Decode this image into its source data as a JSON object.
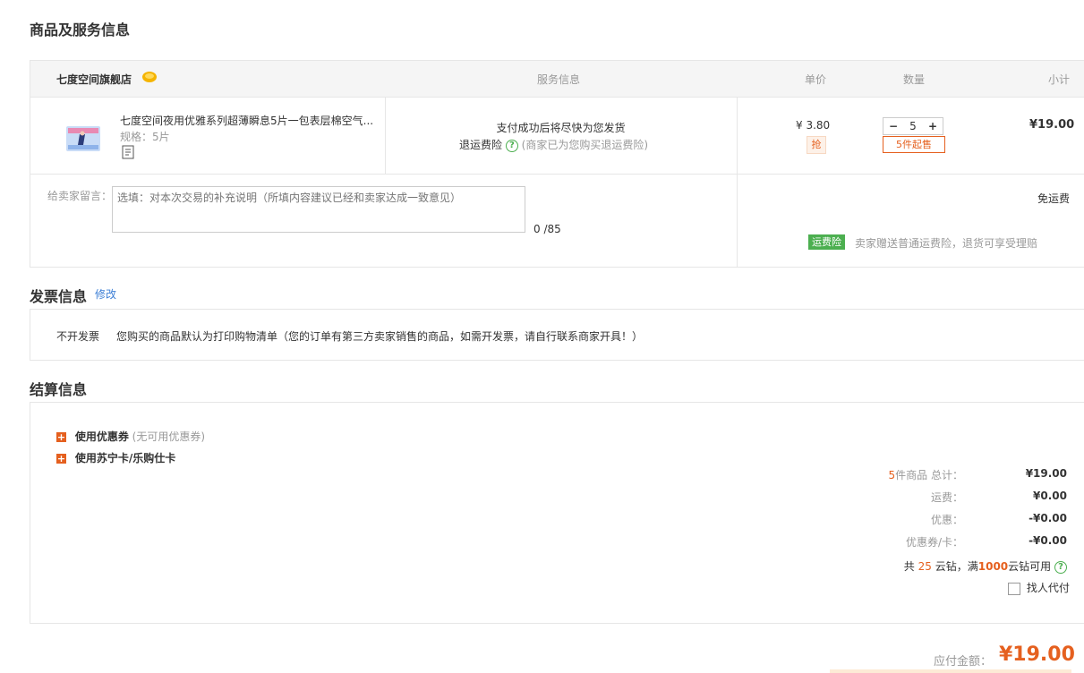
{
  "goods": {
    "title": "商品及服务信息",
    "headers": {
      "store": "七度空间旗舰店",
      "service": "服务信息",
      "price": "单价",
      "qty": "数量",
      "subtotal": "小计"
    },
    "item": {
      "name": "七度空间夜用优雅系列超薄瞬息5片一包表层棉空气...",
      "spec": "规格：5片",
      "service_line1": "支付成功后将尽快为您发货",
      "insurance_label": "退运费险",
      "insurance_note": "(商家已为您购买退运费险)",
      "price": "¥ 3.80",
      "grab_badge": "抢",
      "qty_minus": "−",
      "qty_value": "5",
      "qty_plus": "+",
      "min_order": "5件起售",
      "subtotal": "¥19.00"
    },
    "message": {
      "label": "给卖家留言：",
      "placeholder": "选填：对本次交易的补充说明（所填内容建议已经和卖家达成一致意见）",
      "counter": "0 /85"
    },
    "shipping": {
      "free": "免运费",
      "badge": "运费险",
      "note": "卖家赠送普通运费险，退货可享受理赔"
    }
  },
  "invoice": {
    "title": "发票信息",
    "edit": "修改",
    "type": "不开发票",
    "note": "您购买的商品默认为打印购物清单（您的订单有第三方卖家销售的商品，如需开发票，请自行联系商家开具！）"
  },
  "settlement": {
    "title": "结算信息",
    "coupon_label": "使用优惠券",
    "coupon_note": "(无可用优惠券)",
    "card_label": "使用苏宁卡/乐购仕卡",
    "lines": [
      {
        "count": "5",
        "label": "件商品 总计：",
        "value": "¥19.00"
      },
      {
        "label": "运费：",
        "value": "¥0.00"
      },
      {
        "label": "优惠：",
        "value": "-¥0.00"
      },
      {
        "label": "优惠券/卡：",
        "value": "-¥0.00"
      }
    ],
    "diamond": {
      "prefix": "共",
      "count": "25",
      "mid": "云钻，满",
      "threshold": "1000",
      "suffix": "云钻可用"
    },
    "proxy_pay": "找人代付",
    "payable_label": "应付金额：",
    "payable_value": "¥19.00"
  },
  "colors": {
    "accent": "#e5601f",
    "green": "#4caf50",
    "border": "#e6e6e6",
    "header_bg": "#f5f5f5"
  }
}
